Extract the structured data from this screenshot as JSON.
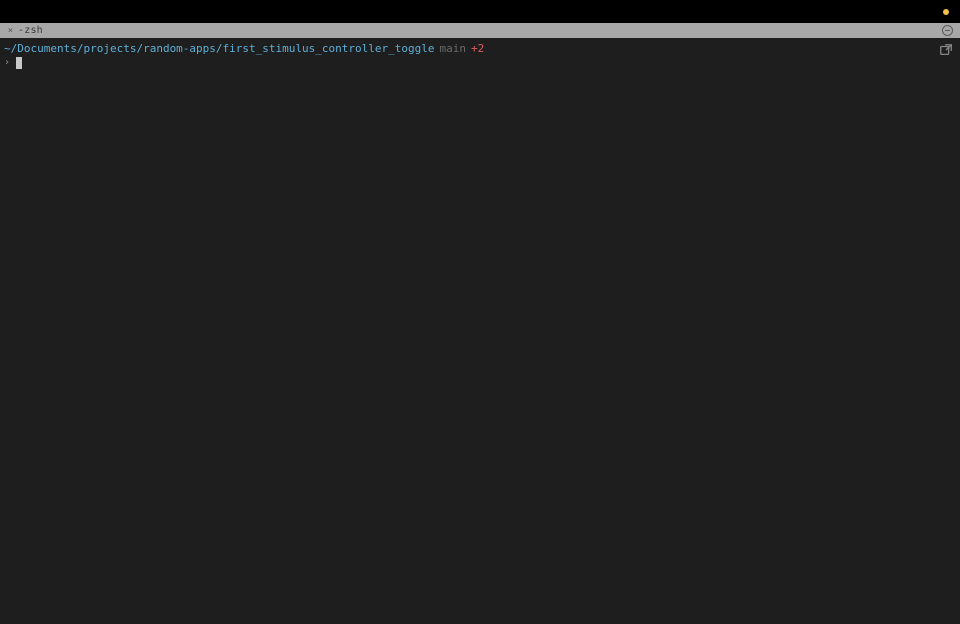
{
  "titlebar": {},
  "tabbar": {
    "close_label": "×",
    "tab_title": "-zsh"
  },
  "terminal": {
    "prompt": {
      "cwd": "~/Documents/projects/random-apps/first_stimulus_controller_toggle",
      "branch": "main",
      "git_status": "+2",
      "caret": "›"
    }
  }
}
